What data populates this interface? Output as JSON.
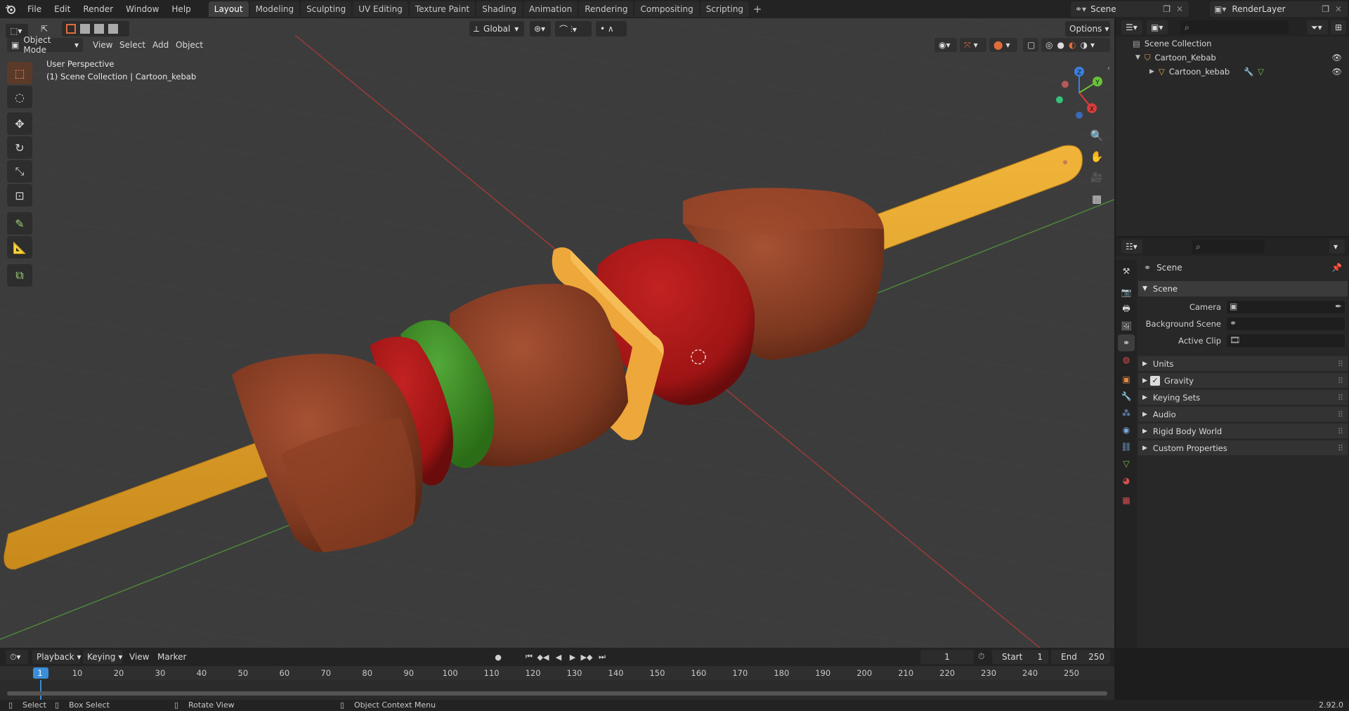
{
  "topbar": {
    "menus": [
      "File",
      "Edit",
      "Render",
      "Window",
      "Help"
    ],
    "workspaces": [
      "Layout",
      "Modeling",
      "Sculpting",
      "UV Editing",
      "Texture Paint",
      "Shading",
      "Animation",
      "Rendering",
      "Compositing",
      "Scripting"
    ],
    "active_workspace": "Layout",
    "add_tab": "+",
    "scene": "Scene",
    "view_layer": "RenderLayer"
  },
  "viewport_header": {
    "mode": "Object Mode",
    "menus": [
      "View",
      "Select",
      "Add",
      "Object"
    ],
    "transform_orientation": "Global",
    "options": "Options"
  },
  "viewport": {
    "perspective": "User Perspective",
    "collection_info": "(1) Scene Collection | Cartoon_kebab",
    "gizmo": {
      "x": "X",
      "y": "Y",
      "z": "Z"
    }
  },
  "outliner": {
    "root": "Scene Collection",
    "collection": "Cartoon_Kebab",
    "object": "Cartoon_kebab"
  },
  "properties": {
    "context": "Scene",
    "panel": "Scene",
    "camera_label": "Camera",
    "background_scene_label": "Background Scene",
    "active_clip_label": "Active Clip",
    "subpanels": [
      "Units",
      "Gravity",
      "Keying Sets",
      "Audio",
      "Rigid Body World",
      "Custom Properties"
    ],
    "gravity_checked": true
  },
  "timeline": {
    "menus": [
      "Playback",
      "Keying",
      "View",
      "Marker"
    ],
    "current_frame": "1",
    "start_label": "Start",
    "start_value": "1",
    "end_label": "End",
    "end_value": "250",
    "ruler_labels": [
      "1",
      "10",
      "20",
      "30",
      "40",
      "50",
      "60",
      "70",
      "80",
      "90",
      "100",
      "110",
      "120",
      "130",
      "140",
      "150",
      "160",
      "170",
      "180",
      "190",
      "200",
      "210",
      "220",
      "230",
      "240",
      "250"
    ]
  },
  "statusbar": {
    "select": "Select",
    "box_select": "Box Select",
    "rotate_view": "Rotate View",
    "context_menu": "Object Context Menu",
    "version": "2.92.0"
  },
  "colors": {
    "accent": "#e06c3a",
    "skewer": "#e3a12a",
    "meat": "#8a3d22",
    "tomato": "#a81a1a",
    "pepper": "#3a8a22",
    "onion": "#eaa43a"
  }
}
